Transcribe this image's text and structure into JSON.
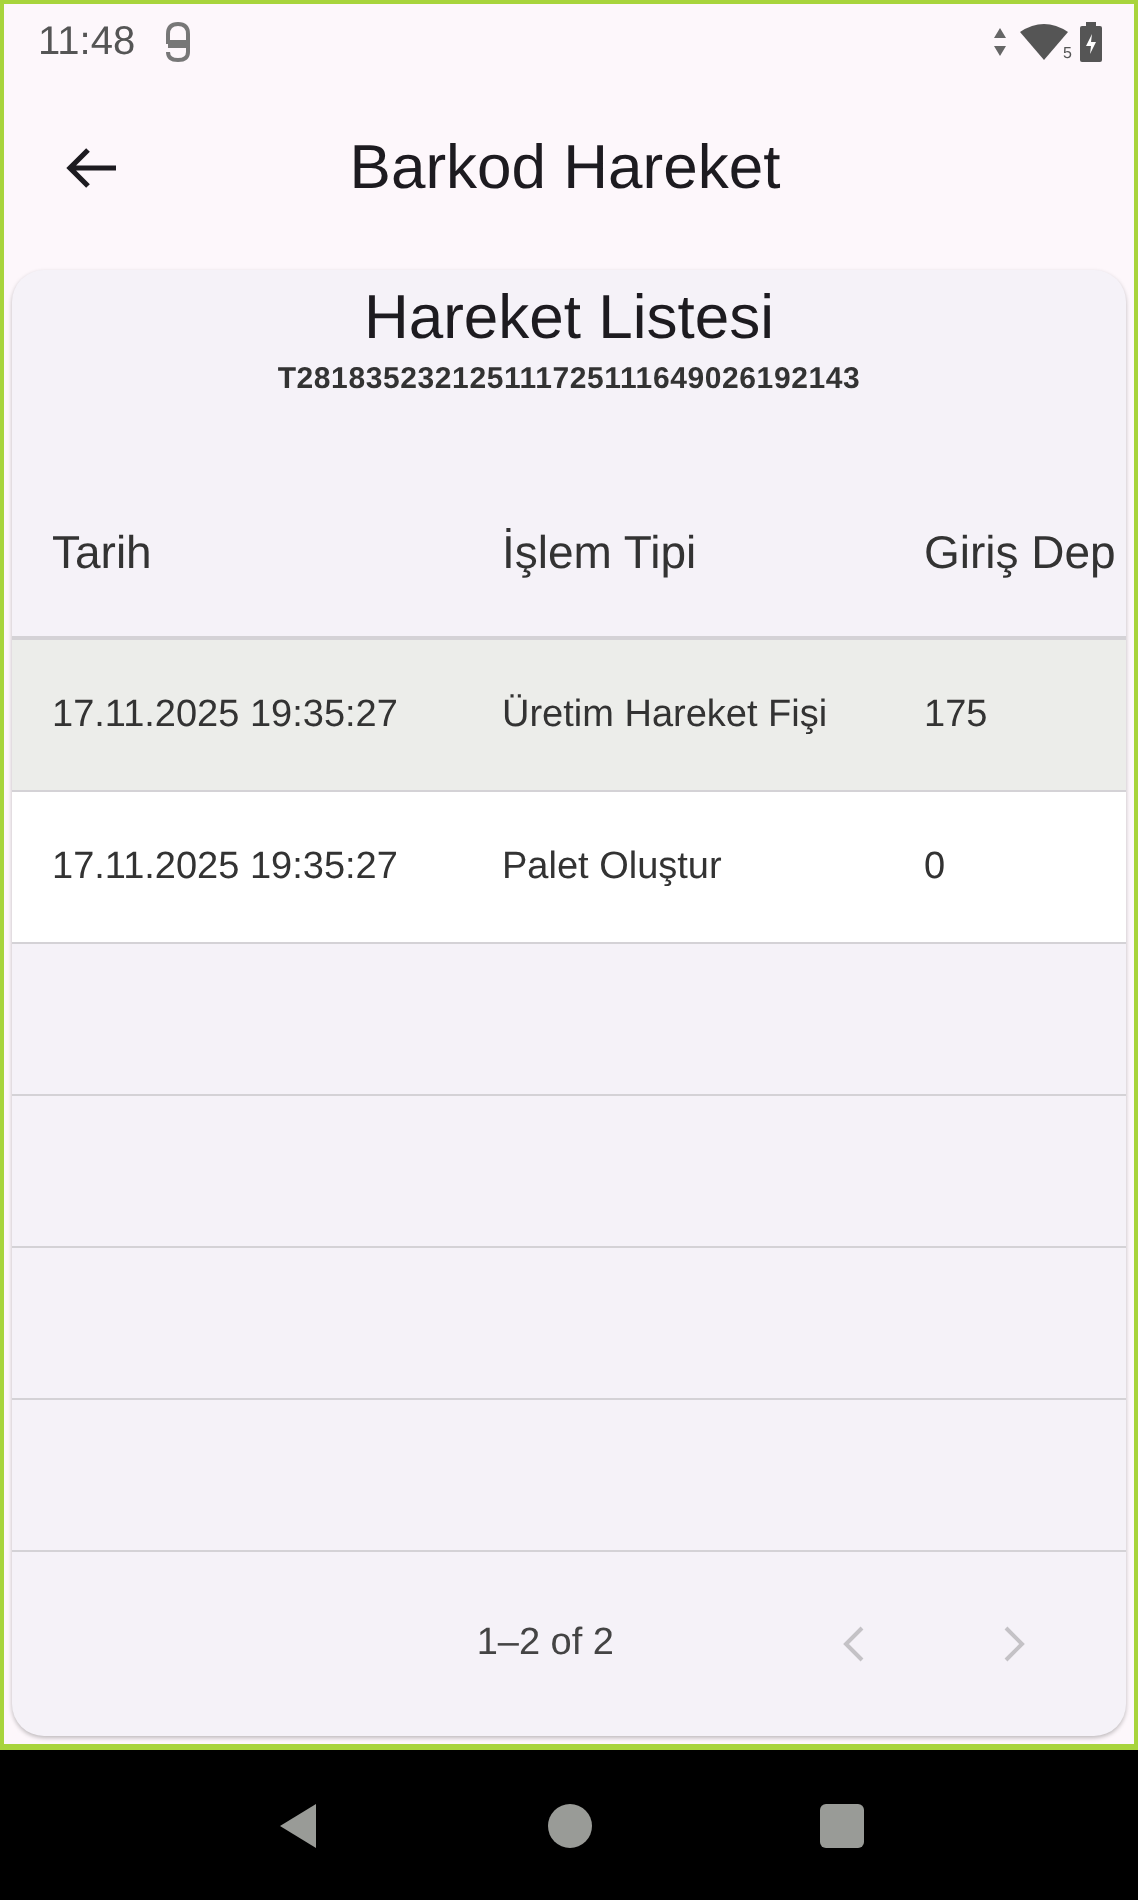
{
  "status_bar": {
    "time": "11:48",
    "wifi_badge": "5"
  },
  "app_bar": {
    "title": "Barkod Hareket"
  },
  "card": {
    "title": "Hareket Listesi",
    "subtitle": "T281835232125111725111649026192143"
  },
  "table": {
    "columns": [
      "Tarih",
      "İşlem Tipi",
      "Giriş Dep"
    ],
    "rows": [
      {
        "cells": [
          "17.11.2025 19:35:27",
          "Üretim Hareket Fişi",
          "175"
        ],
        "selected": true
      },
      {
        "cells": [
          "17.11.2025 19:35:27",
          "Palet Oluştur",
          "0"
        ],
        "selected": false
      }
    ]
  },
  "pagination": {
    "range": "1–2 of 2",
    "prev_disabled": true,
    "next_disabled": true
  }
}
